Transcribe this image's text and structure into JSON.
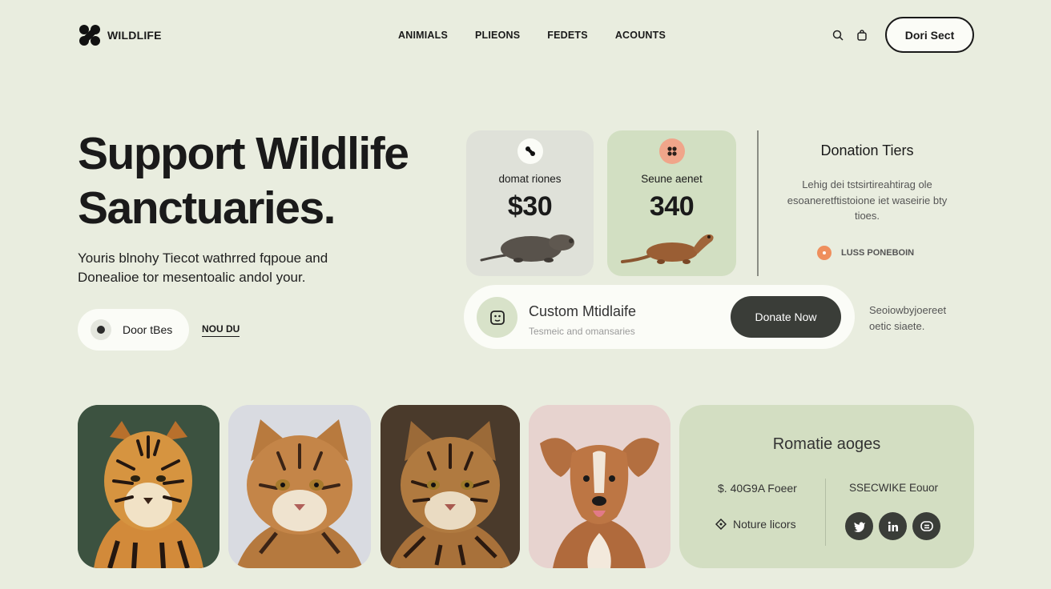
{
  "brand": {
    "name": "WILDLIFE"
  },
  "nav": {
    "links": [
      "ANIMIALS",
      "PLIEONS",
      "FEDETS",
      "ACOUNTS"
    ],
    "icons": [
      "search-icon",
      "bag-icon"
    ],
    "cta": "Dori Sect"
  },
  "hero": {
    "title": "Support Wildlife Sanctuaries.",
    "subtitle": "Youris blnohy Tiecot wathrred fqpoue and Donealioe tor mesentoalic andol your.",
    "primary_button": "Door tBes",
    "secondary_link": "NOU DU"
  },
  "donations": {
    "cards": [
      {
        "label": "domat riones",
        "amount": "$30",
        "icon": "paw-icon",
        "animal": "mole"
      },
      {
        "label": "Seune aenet",
        "amount": "340",
        "icon": "paw-icon",
        "animal": "mongoose"
      }
    ],
    "tiers": {
      "title": "Donation Tiers",
      "description": "Lehig dei tstsirtireahtirag ole esoaneretftistoione iet waseirie bty tioes.",
      "badge": "LUSS PONEBOIN"
    },
    "custom": {
      "title": "Custom Mtidlaife",
      "subtitle": "Tesmeic and omansaries",
      "button": "Donate Now"
    },
    "side_note": "Seoiowbyjoereet oetic siaete."
  },
  "gallery": {
    "animals": [
      "tiger",
      "wildcat",
      "bengal-cat",
      "dog"
    ]
  },
  "info": {
    "title": "Romatie aoges",
    "left_line_1": "$. 40G9A Foeer",
    "left_line_2": "Noture licors",
    "right_line_1": "SSECWIKE Eouor",
    "socials": [
      "twitter-icon",
      "linkedin-icon",
      "chat-icon"
    ]
  },
  "colors": {
    "background": "#e9eddf",
    "card_green": "#d2dfc2",
    "dark_button": "#3a3d38",
    "accent_orange": "#ef8f5d"
  }
}
